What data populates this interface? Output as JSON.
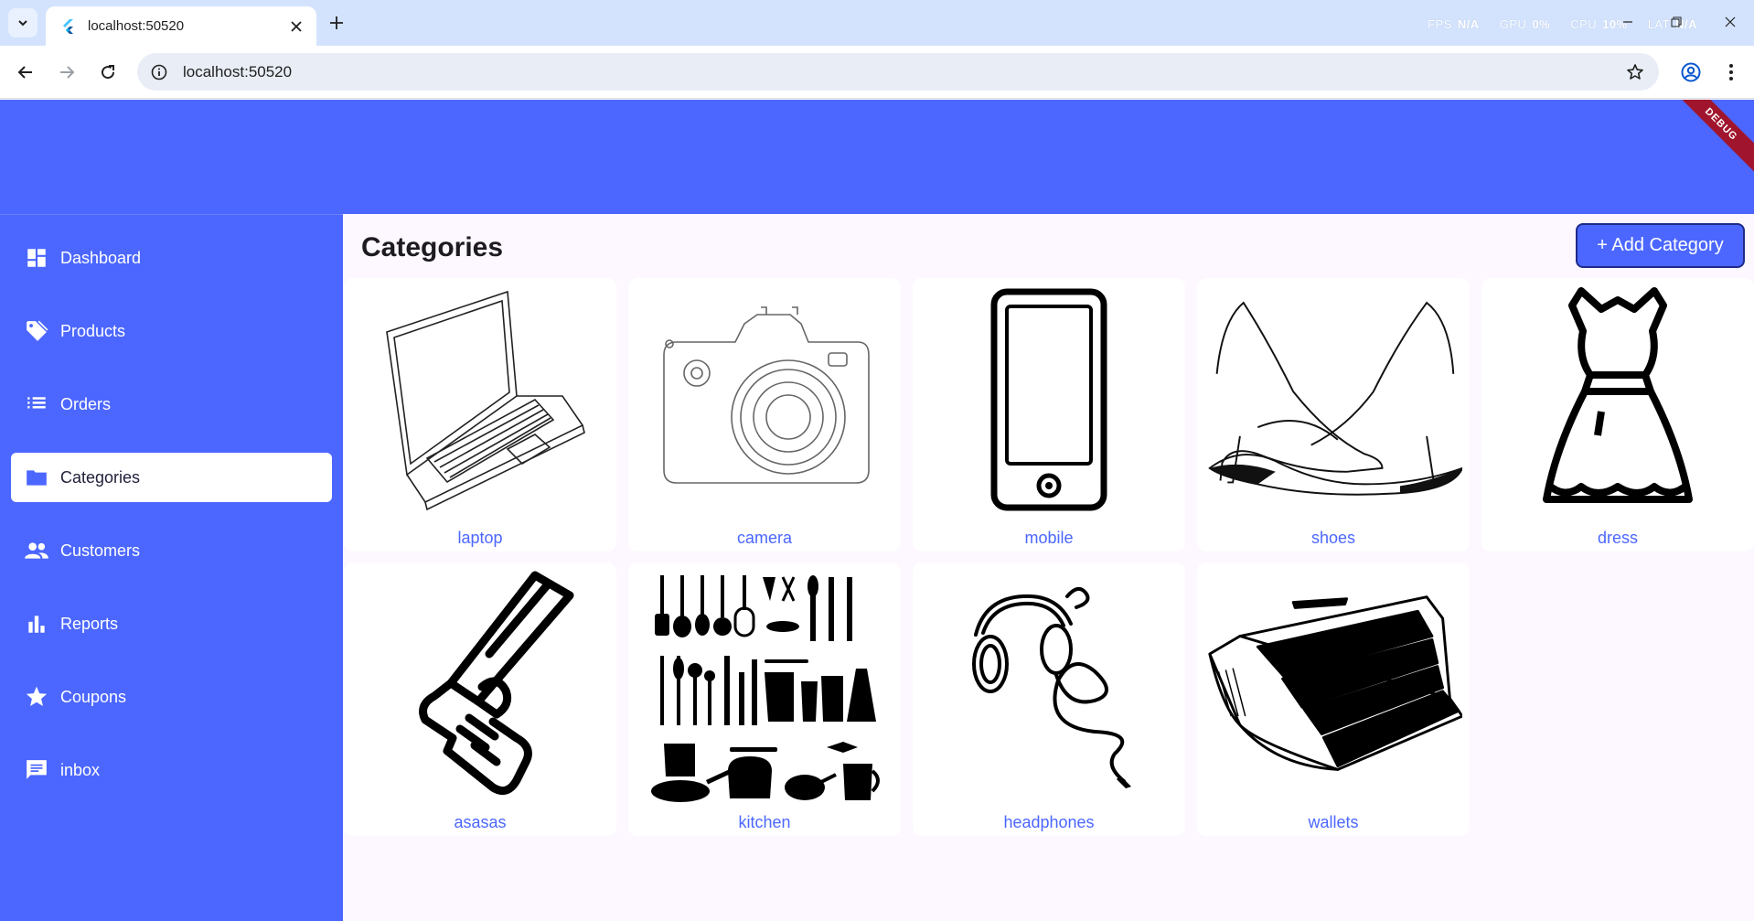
{
  "browser": {
    "tab_title": "localhost:50520",
    "url": "localhost:50520",
    "perf": {
      "fps_label": "FPS",
      "fps_value": "N/A",
      "gpu_label": "GPU",
      "gpu_value": "0%",
      "cpu_label": "CPU",
      "cpu_value": "10%",
      "lat_label": "LAT",
      "lat_value": "N/A"
    }
  },
  "app": {
    "debug_banner": "DEBUG",
    "sidebar": {
      "items": [
        {
          "label": "Dashboard",
          "icon": "dashboard-icon"
        },
        {
          "label": "Products",
          "icon": "tag-icon"
        },
        {
          "label": "Orders",
          "icon": "list-icon"
        },
        {
          "label": "Categories",
          "icon": "folder-icon",
          "active": true
        },
        {
          "label": "Customers",
          "icon": "people-icon"
        },
        {
          "label": "Reports",
          "icon": "bar-chart-icon"
        },
        {
          "label": "Coupons",
          "icon": "star-icon"
        },
        {
          "label": "inbox",
          "icon": "chat-icon"
        }
      ]
    },
    "main": {
      "title": "Categories",
      "add_button": "+ Add Category",
      "categories": [
        {
          "name": "laptop",
          "icon": "laptop-image"
        },
        {
          "name": "camera",
          "icon": "camera-image"
        },
        {
          "name": "mobile",
          "icon": "mobile-image"
        },
        {
          "name": "shoes",
          "icon": "shoes-image"
        },
        {
          "name": "dress",
          "icon": "dress-image"
        },
        {
          "name": "asasas",
          "icon": "pistol-image"
        },
        {
          "name": "kitchen",
          "icon": "kitchen-image"
        },
        {
          "name": "headphones",
          "icon": "headphones-image"
        },
        {
          "name": "wallets",
          "icon": "wallet-image"
        }
      ]
    },
    "colors": {
      "accent": "#4c67ff",
      "background": "#fdf7ff",
      "tabbar": "#d3e3fd"
    }
  }
}
